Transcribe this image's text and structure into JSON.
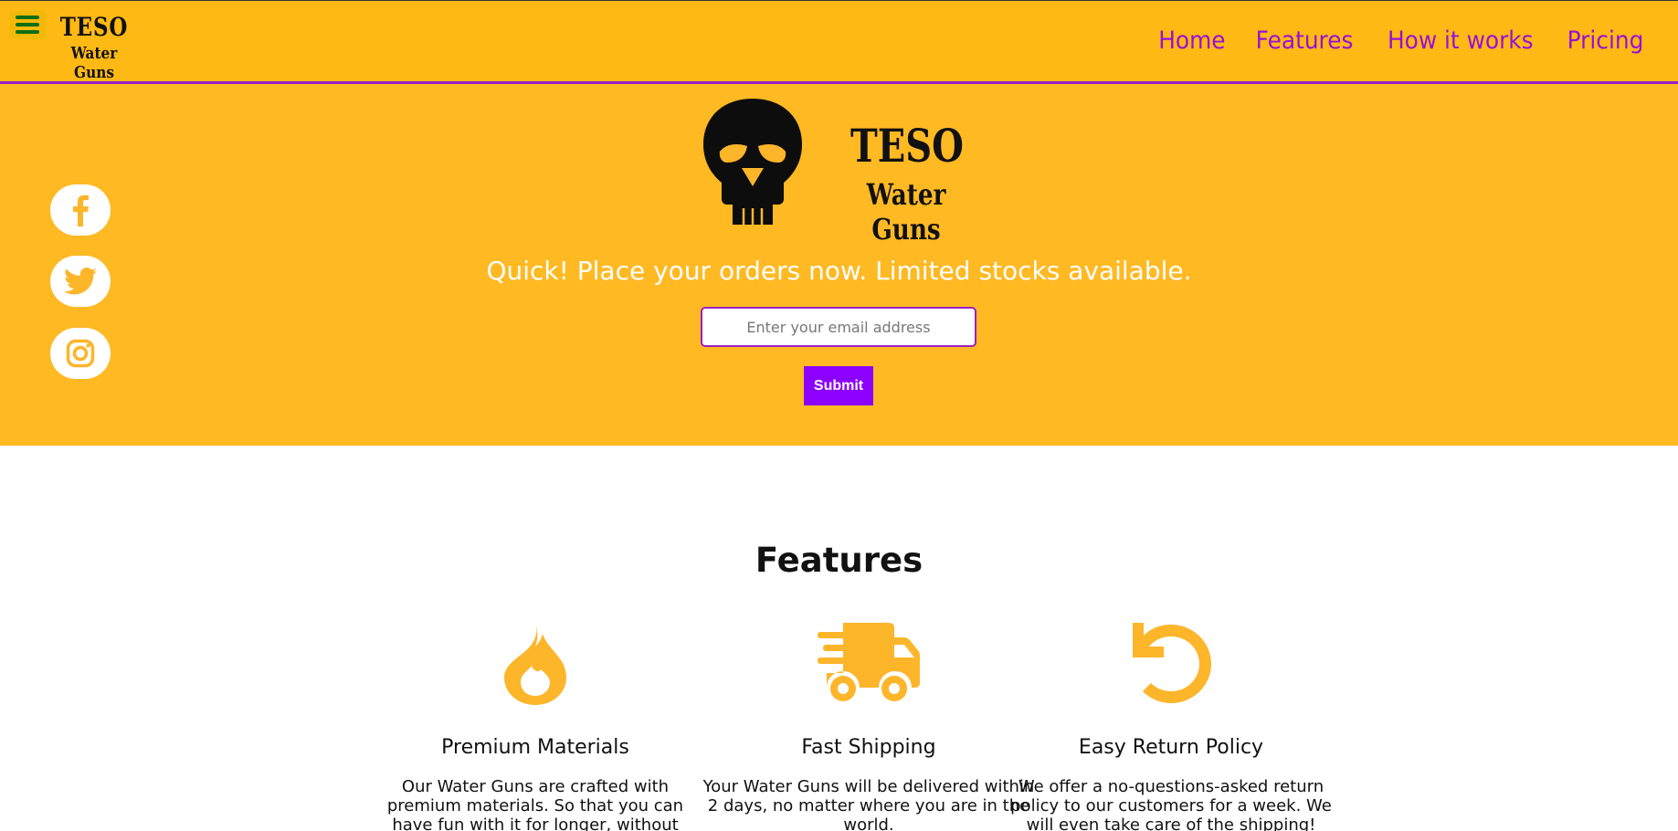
{
  "header": {
    "brand_line1": "TESO",
    "brand_line2": "Water Guns",
    "nav": [
      "Home",
      "Features",
      "How it works",
      "Pricing"
    ]
  },
  "hero": {
    "logo_line1": "TESO",
    "logo_line2": "Water Guns",
    "tagline": "Quick! Place your orders now. Limited stocks available.",
    "email_placeholder": "Enter your email address",
    "submit_label": "Submit",
    "social": [
      "facebook-icon",
      "twitter-icon",
      "instagram-icon"
    ]
  },
  "features": {
    "title": "Features",
    "items": [
      {
        "icon": "fire-icon",
        "title": "Premium Materials",
        "text": "Our Water Guns are crafted with premium materials. So that you can have fun with it for longer, without worrying about breaking it!"
      },
      {
        "icon": "shipping-fast-icon",
        "title": "Fast Shipping",
        "text": "Your Water Guns will be delivered within 2 days, no matter where you are in the world."
      },
      {
        "icon": "undo-icon",
        "title": "Easy Return Policy",
        "text": "We offer a no-questions-asked return policy to our customers for a week. We will even take care of the shipping!"
      }
    ]
  },
  "colors": {
    "header_bg": "#ffb914",
    "hero_bg": "#ffb923",
    "nav_link": "#9810d6",
    "button": "#8c00ff",
    "icon": "#fdb52a"
  }
}
